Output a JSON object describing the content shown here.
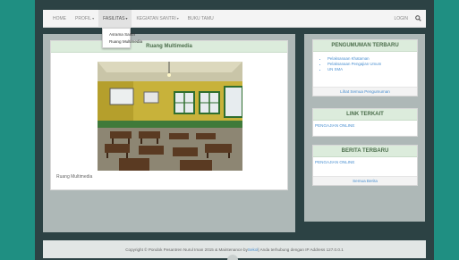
{
  "nav": {
    "items": [
      {
        "label": "HOME",
        "caret": ""
      },
      {
        "label": "PROFIL",
        "caret": "▾"
      },
      {
        "label": "FASILITAS",
        "caret": "▾"
      },
      {
        "label": "KEGIATAN SANTRI",
        "caret": "▾"
      },
      {
        "label": "BUKU TAMU",
        "caret": ""
      }
    ],
    "login": "LOGIN",
    "search_icon": "search-icon"
  },
  "dropdown": {
    "items": [
      "Asrama Santri",
      "Ruang Multimedia"
    ]
  },
  "main": {
    "title": "Ruang Multimedia",
    "caption": "Ruang Multimedia"
  },
  "sidebar": {
    "announcements": {
      "title": "PENGUMUMAN TERBARU",
      "items": [
        "Pelaksanaan Khataman",
        "Pelaksanaan Pengajian Umum",
        "UN SMA"
      ],
      "more": "Lihat Semua Pengumuman"
    },
    "links": {
      "title": "LINK TERKAIT",
      "items": [
        "PENGAJIAN ONLINE"
      ]
    },
    "news": {
      "title": "BERITA TERBARU",
      "items": [
        "PENGAJIAN ONLINE"
      ],
      "more": "Semua Berita"
    }
  },
  "footer": {
    "pre": "Copyright © Pondok Pesantren Nurul Iman 2015 & Maintenance by ",
    "powered": "Sekol",
    "post": " | Anda terhubung dengan IP Address 127.0.0.1"
  },
  "colors": {
    "background": "#1f8f82",
    "panel": "#aeb8b7",
    "title_bar": "#dcecdc",
    "link": "#4a8fd0"
  }
}
